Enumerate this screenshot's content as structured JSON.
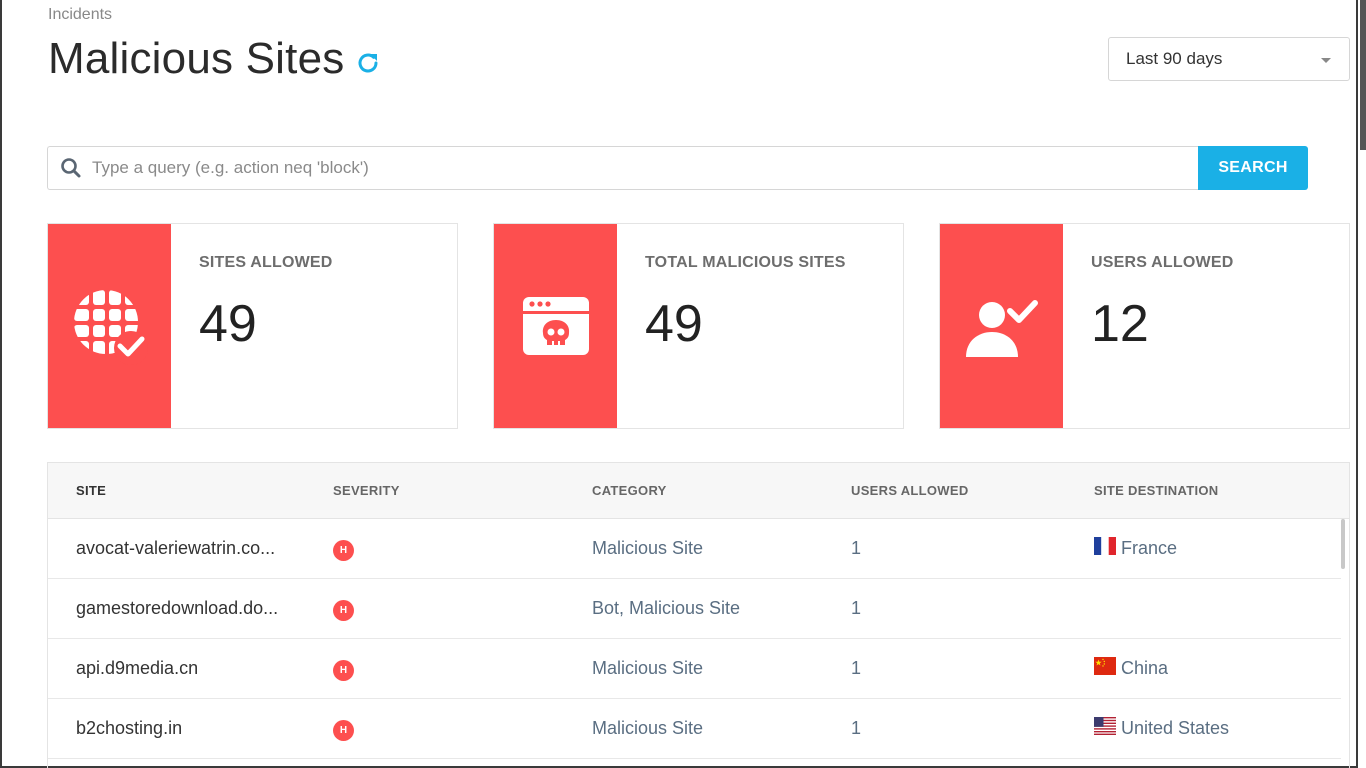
{
  "breadcrumb": "Incidents",
  "page_title": "Malicious Sites",
  "date_range": {
    "selected": "Last 90 days"
  },
  "search": {
    "placeholder": "Type a query (e.g. action neq 'block')",
    "button_label": "SEARCH"
  },
  "cards": [
    {
      "label": "SITES ALLOWED",
      "value": "49",
      "icon": "globe-check-icon"
    },
    {
      "label": "TOTAL MALICIOUS SITES",
      "value": "49",
      "icon": "browser-skull-icon"
    },
    {
      "label": "USERS ALLOWED",
      "value": "12",
      "icon": "user-check-icon"
    }
  ],
  "table": {
    "columns": [
      "SITE",
      "SEVERITY",
      "CATEGORY",
      "USERS ALLOWED",
      "SITE DESTINATION"
    ],
    "rows": [
      {
        "site": "avocat-valeriewatrin.co...",
        "severity": "H",
        "category": "Malicious Site",
        "users_allowed": "1",
        "destination": "France",
        "flag": "france-flag-icon"
      },
      {
        "site": "gamestoredownload.do...",
        "severity": "H",
        "category": "Bot, Malicious Site",
        "users_allowed": "1",
        "destination": "",
        "flag": ""
      },
      {
        "site": "api.d9media.cn",
        "severity": "H",
        "category": "Malicious Site",
        "users_allowed": "1",
        "destination": "China",
        "flag": "china-flag-icon"
      },
      {
        "site": "b2chosting.in",
        "severity": "H",
        "category": "Malicious Site",
        "users_allowed": "1",
        "destination": "United States",
        "flag": "usa-flag-icon"
      }
    ]
  },
  "colors": {
    "accent": "#1ab0e6",
    "card_icon_bg": "#fd4f4f",
    "severity_high": "#fd4f4f"
  }
}
